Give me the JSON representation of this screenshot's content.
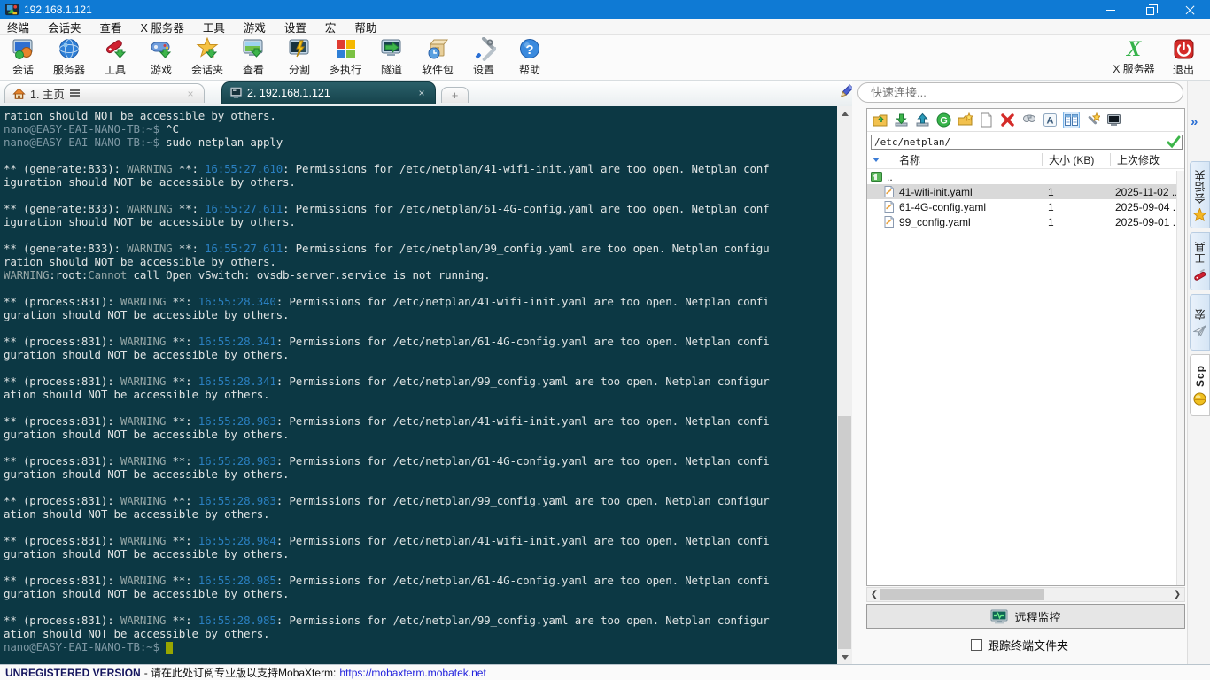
{
  "window": {
    "title": "192.168.1.121"
  },
  "menu": {
    "items": [
      "终端",
      "会话夹",
      "查看",
      "X 服务器",
      "工具",
      "游戏",
      "设置",
      "宏",
      "帮助"
    ]
  },
  "toolbar": {
    "items": [
      {
        "label": "会话",
        "icon": "sessions-icon"
      },
      {
        "label": "服务器",
        "icon": "servers-icon"
      },
      {
        "label": "工具",
        "icon": "tools-icon"
      },
      {
        "label": "游戏",
        "icon": "games-icon"
      },
      {
        "label": "会话夹",
        "icon": "sessions-folder-icon"
      },
      {
        "label": "查看",
        "icon": "view-icon"
      },
      {
        "label": "分割",
        "icon": "split-icon"
      },
      {
        "label": "多执行",
        "icon": "multiexec-icon"
      },
      {
        "label": "隧道",
        "icon": "tunnel-icon"
      },
      {
        "label": "软件包",
        "icon": "packages-icon"
      },
      {
        "label": "设置",
        "icon": "settings-icon"
      },
      {
        "label": "帮助",
        "icon": "help-icon"
      }
    ],
    "xserver": {
      "label": "X 服务器",
      "icon": "x-server-icon"
    },
    "exit": {
      "label": "退出",
      "icon": "exit-icon"
    }
  },
  "tabs": {
    "items": [
      {
        "label": "1. 主页",
        "icon": "home-icon"
      },
      {
        "label": "2. 192.168.1.121",
        "icon": "terminal-icon"
      }
    ],
    "plus": "+"
  },
  "terminal": {
    "prompt": "nano@EASY-EAI-NANO-TB:~$",
    "lines": [
      [
        [
          "w",
          "ration should NOT be accessible by others."
        ]
      ],
      [
        [
          "p",
          "nano@EASY-EAI-NANO-TB:~$"
        ],
        [
          "w",
          " ^C"
        ]
      ],
      [
        [
          "p",
          "nano@EASY-EAI-NANO-TB:~$"
        ],
        [
          "w",
          " sudo netplan apply"
        ]
      ],
      [],
      [
        [
          "w",
          "** (generate:833): "
        ],
        [
          "g",
          "WARNING"
        ],
        [
          "w",
          " **: "
        ],
        [
          "b",
          "16:55:27.610"
        ],
        [
          "w",
          ": Permissions for /etc/netplan/41-wifi-init.yaml are too open. Netplan conf"
        ]
      ],
      [
        [
          "w",
          "iguration should NOT be accessible by others."
        ]
      ],
      [],
      [
        [
          "w",
          "** (generate:833): "
        ],
        [
          "g",
          "WARNING"
        ],
        [
          "w",
          " **: "
        ],
        [
          "b",
          "16:55:27.611"
        ],
        [
          "w",
          ": Permissions for /etc/netplan/61-4G-config.yaml are too open. Netplan conf"
        ]
      ],
      [
        [
          "w",
          "iguration should NOT be accessible by others."
        ]
      ],
      [],
      [
        [
          "w",
          "** (generate:833): "
        ],
        [
          "g",
          "WARNING"
        ],
        [
          "w",
          " **: "
        ],
        [
          "b",
          "16:55:27.611"
        ],
        [
          "w",
          ": Permissions for /etc/netplan/99_config.yaml are too open. Netplan configu"
        ]
      ],
      [
        [
          "w",
          "ration should NOT be accessible by others."
        ]
      ],
      [
        [
          "g",
          "WARNING"
        ],
        [
          "w",
          ":root:"
        ],
        [
          "g",
          "Cannot"
        ],
        [
          "w",
          " call Open vSwitch: ovsdb-server.service is not running."
        ]
      ],
      [],
      [
        [
          "w",
          "** (process:831): "
        ],
        [
          "g",
          "WARNING"
        ],
        [
          "w",
          " **: "
        ],
        [
          "b",
          "16:55:28.340"
        ],
        [
          "w",
          ": Permissions for /etc/netplan/41-wifi-init.yaml are too open. Netplan confi"
        ]
      ],
      [
        [
          "w",
          "guration should NOT be accessible by others."
        ]
      ],
      [],
      [
        [
          "w",
          "** (process:831): "
        ],
        [
          "g",
          "WARNING"
        ],
        [
          "w",
          " **: "
        ],
        [
          "b",
          "16:55:28.341"
        ],
        [
          "w",
          ": Permissions for /etc/netplan/61-4G-config.yaml are too open. Netplan confi"
        ]
      ],
      [
        [
          "w",
          "guration should NOT be accessible by others."
        ]
      ],
      [],
      [
        [
          "w",
          "** (process:831): "
        ],
        [
          "g",
          "WARNING"
        ],
        [
          "w",
          " **: "
        ],
        [
          "b",
          "16:55:28.341"
        ],
        [
          "w",
          ": Permissions for /etc/netplan/99_config.yaml are too open. Netplan configur"
        ]
      ],
      [
        [
          "w",
          "ation should NOT be accessible by others."
        ]
      ],
      [],
      [
        [
          "w",
          "** (process:831): "
        ],
        [
          "g",
          "WARNING"
        ],
        [
          "w",
          " **: "
        ],
        [
          "b",
          "16:55:28.983"
        ],
        [
          "w",
          ": Permissions for /etc/netplan/41-wifi-init.yaml are too open. Netplan confi"
        ]
      ],
      [
        [
          "w",
          "guration should NOT be accessible by others."
        ]
      ],
      [],
      [
        [
          "w",
          "** (process:831): "
        ],
        [
          "g",
          "WARNING"
        ],
        [
          "w",
          " **: "
        ],
        [
          "b",
          "16:55:28.983"
        ],
        [
          "w",
          ": Permissions for /etc/netplan/61-4G-config.yaml are too open. Netplan confi"
        ]
      ],
      [
        [
          "w",
          "guration should NOT be accessible by others."
        ]
      ],
      [],
      [
        [
          "w",
          "** (process:831): "
        ],
        [
          "g",
          "WARNING"
        ],
        [
          "w",
          " **: "
        ],
        [
          "b",
          "16:55:28.983"
        ],
        [
          "w",
          ": Permissions for /etc/netplan/99_config.yaml are too open. Netplan configur"
        ]
      ],
      [
        [
          "w",
          "ation should NOT be accessible by others."
        ]
      ],
      [],
      [
        [
          "w",
          "** (process:831): "
        ],
        [
          "g",
          "WARNING"
        ],
        [
          "w",
          " **: "
        ],
        [
          "b",
          "16:55:28.984"
        ],
        [
          "w",
          ": Permissions for /etc/netplan/41-wifi-init.yaml are too open. Netplan confi"
        ]
      ],
      [
        [
          "w",
          "guration should NOT be accessible by others."
        ]
      ],
      [],
      [
        [
          "w",
          "** (process:831): "
        ],
        [
          "g",
          "WARNING"
        ],
        [
          "w",
          " **: "
        ],
        [
          "b",
          "16:55:28.985"
        ],
        [
          "w",
          ": Permissions for /etc/netplan/61-4G-config.yaml are too open. Netplan confi"
        ]
      ],
      [
        [
          "w",
          "guration should NOT be accessible by others."
        ]
      ],
      [],
      [
        [
          "w",
          "** (process:831): "
        ],
        [
          "g",
          "WARNING"
        ],
        [
          "w",
          " **: "
        ],
        [
          "b",
          "16:55:28.985"
        ],
        [
          "w",
          ": Permissions for /etc/netplan/99_config.yaml are too open. Netplan configur"
        ]
      ],
      [
        [
          "w",
          "ation should NOT be accessible by others."
        ]
      ],
      [
        [
          "p",
          "nano@EASY-EAI-NANO-TB:~$"
        ],
        [
          "w",
          " "
        ],
        [
          "cur",
          " "
        ]
      ]
    ]
  },
  "sftp": {
    "quick_connect_placeholder": "快速连接...",
    "path": "/etc/netplan/",
    "columns": [
      "名称",
      "大小 (KB)",
      "上次修改"
    ],
    "updir": "..",
    "files": [
      {
        "name": "41-wifi-init.yaml",
        "size": "1",
        "modified": "2025-11-02 ..."
      },
      {
        "name": "61-4G-config.yaml",
        "size": "1",
        "modified": "2025-09-04 ..."
      },
      {
        "name": "99_config.yaml",
        "size": "1",
        "modified": "2025-09-01 ..."
      }
    ],
    "remote_monitoring": "远程监控",
    "follow_terminal": "跟踪终端文件夹"
  },
  "side_tabs": {
    "expand": "»",
    "items": [
      "会话夹",
      "工具",
      "宏",
      "Scp"
    ]
  },
  "statusbar": {
    "version": "UNREGISTERED VERSION",
    "note": "- 请在此处订阅专业版以支持MobaXterm:",
    "link": "https://mobaxterm.mobatek.net"
  },
  "colors": {
    "titlebar": "#0f7ad4",
    "terminal_bg": "#0c3844",
    "terminal_fg": "#dfe3e3",
    "prompt": "#7e98a4",
    "warning_gray": "#96a7a7",
    "timestamp_blue": "#2a7fc0",
    "cursor": "#98a600",
    "active_tab": "#16434c"
  }
}
